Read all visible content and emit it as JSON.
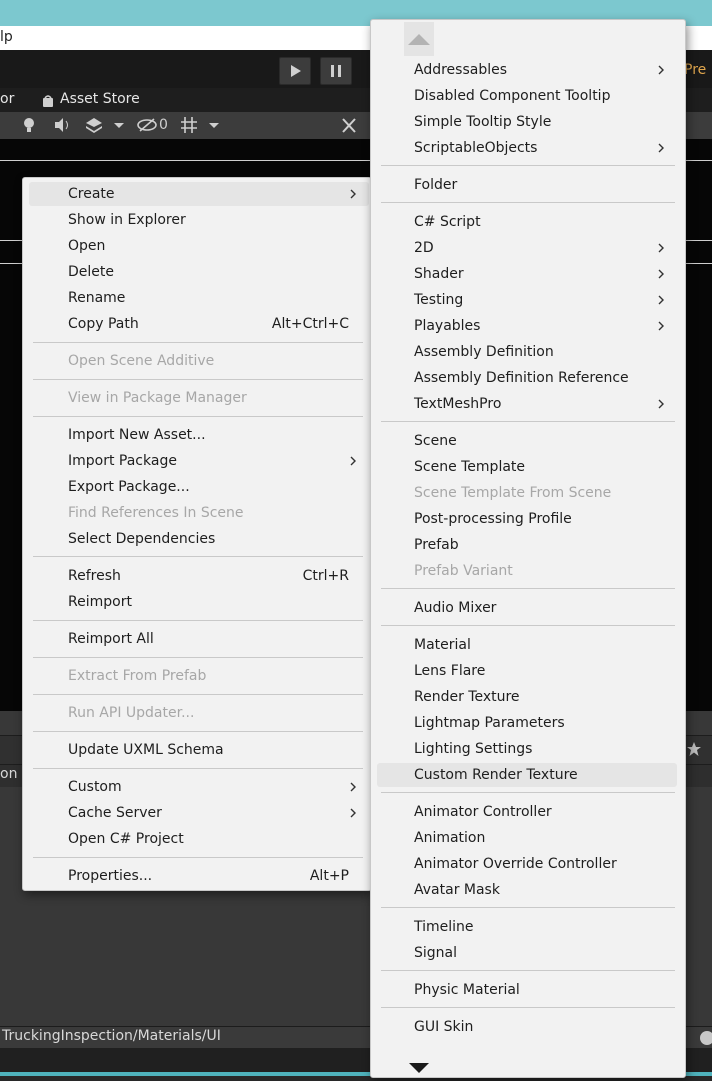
{
  "menubar": {
    "visible_fragment": "lp"
  },
  "toolbar": {
    "pre_label": "Pre"
  },
  "tabs": {
    "left_fragment": "or",
    "asset_store": "Asset Store"
  },
  "scene_toolbar": {
    "hidden_count": "0"
  },
  "lower_panel": {
    "tab_fragment": "on"
  },
  "path_bar": {
    "path": "TruckingInspection/Materials/UI"
  },
  "context_menu": {
    "items": [
      {
        "label": "Create",
        "submenu": true,
        "highlighted": true
      },
      {
        "label": "Show in Explorer"
      },
      {
        "label": "Open"
      },
      {
        "label": "Delete"
      },
      {
        "label": "Rename"
      },
      {
        "label": "Copy Path",
        "shortcut": "Alt+Ctrl+C"
      },
      {
        "label": "Open Scene Additive",
        "disabled": true
      },
      {
        "label": "View in Package Manager",
        "disabled": true
      },
      {
        "label": "Import New Asset..."
      },
      {
        "label": "Import Package",
        "submenu": true
      },
      {
        "label": "Export Package..."
      },
      {
        "label": "Find References In Scene",
        "disabled": true
      },
      {
        "label": "Select Dependencies"
      },
      {
        "label": "Refresh",
        "shortcut": "Ctrl+R"
      },
      {
        "label": "Reimport"
      },
      {
        "label": "Reimport All"
      },
      {
        "label": "Extract From Prefab",
        "disabled": true
      },
      {
        "label": "Run API Updater...",
        "disabled": true
      },
      {
        "label": "Update UXML Schema"
      },
      {
        "label": "Custom",
        "submenu": true
      },
      {
        "label": "Cache Server",
        "submenu": true
      },
      {
        "label": "Open C# Project"
      },
      {
        "label": "Properties...",
        "shortcut": "Alt+P"
      }
    ]
  },
  "create_submenu": {
    "items": [
      {
        "label": "Addressables",
        "submenu": true
      },
      {
        "label": "Disabled Component Tooltip"
      },
      {
        "label": "Simple Tooltip Style"
      },
      {
        "label": "ScriptableObjects",
        "submenu": true
      },
      {
        "label": "Folder"
      },
      {
        "label": "C# Script"
      },
      {
        "label": "2D",
        "submenu": true
      },
      {
        "label": "Shader",
        "submenu": true
      },
      {
        "label": "Testing",
        "submenu": true
      },
      {
        "label": "Playables",
        "submenu": true
      },
      {
        "label": "Assembly Definition"
      },
      {
        "label": "Assembly Definition Reference"
      },
      {
        "label": "TextMeshPro",
        "submenu": true
      },
      {
        "label": "Scene"
      },
      {
        "label": "Scene Template"
      },
      {
        "label": "Scene Template From Scene",
        "disabled": true
      },
      {
        "label": "Post-processing Profile"
      },
      {
        "label": "Prefab"
      },
      {
        "label": "Prefab Variant",
        "disabled": true
      },
      {
        "label": "Audio Mixer"
      },
      {
        "label": "Material"
      },
      {
        "label": "Lens Flare"
      },
      {
        "label": "Render Texture"
      },
      {
        "label": "Lightmap Parameters"
      },
      {
        "label": "Lighting Settings"
      },
      {
        "label": "Custom Render Texture",
        "highlighted": true
      },
      {
        "label": "Animator Controller"
      },
      {
        "label": "Animation"
      },
      {
        "label": "Animator Override Controller"
      },
      {
        "label": "Avatar Mask"
      },
      {
        "label": "Timeline"
      },
      {
        "label": "Signal"
      },
      {
        "label": "Physic Material"
      },
      {
        "label": "GUI Skin"
      }
    ]
  }
}
